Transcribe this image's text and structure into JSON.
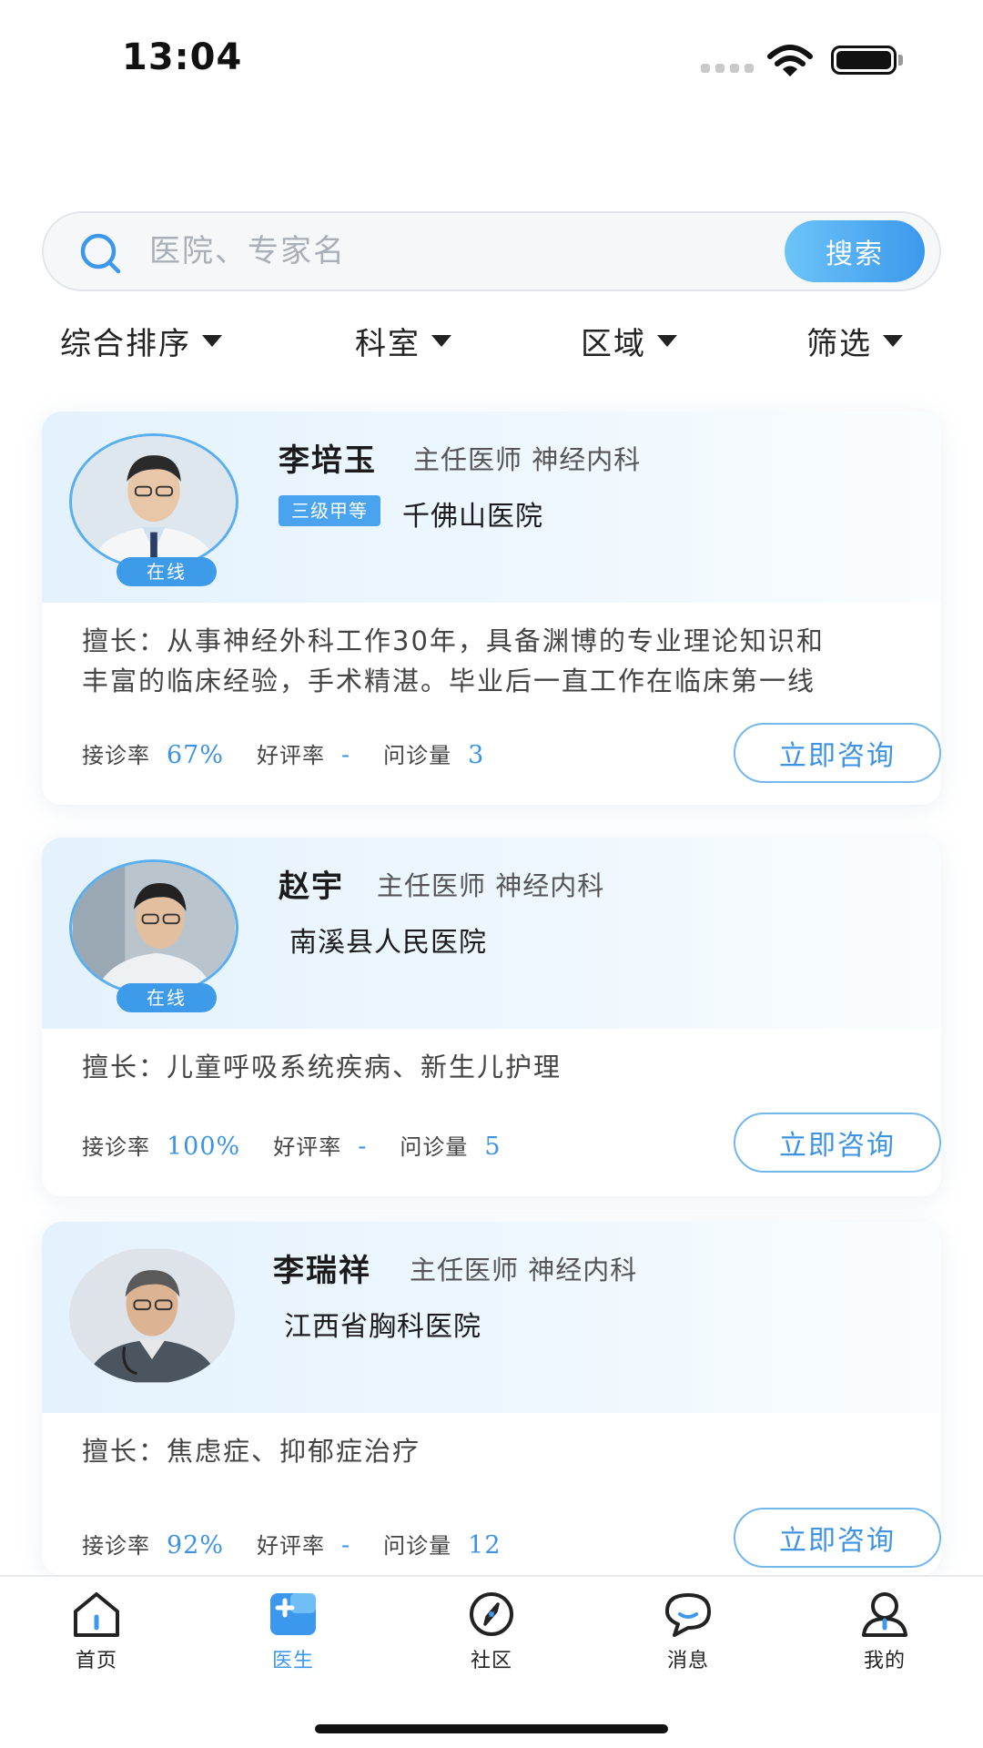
{
  "status_bar": {
    "time": "13:04"
  },
  "search": {
    "placeholder": "医院、专家名",
    "button_label": "搜索"
  },
  "filters": [
    {
      "label": "综合排序"
    },
    {
      "label": "科室"
    },
    {
      "label": "区域"
    },
    {
      "label": "筛选"
    }
  ],
  "doctors": [
    {
      "name": "李培玉",
      "title": "主任医师  神经内科",
      "level": "三级甲等",
      "hospital": "千佛山医院",
      "online": "在线",
      "specialty_line1": "擅长：从事神经外科工作30年，具备渊博的专业理论知识和",
      "specialty_line2": "丰富的临床经验，手术精湛。毕业后一直工作在临床第一线",
      "stats": {
        "rate_label": "接诊率",
        "rate": "67%",
        "praise_label": "好评率",
        "praise": "-",
        "count_label": "问诊量",
        "count": "3"
      },
      "consult_label": "立即咨询"
    },
    {
      "name": "赵宇",
      "title": "主任医师  神经内科",
      "hospital": "南溪县人民医院",
      "online": "在线",
      "specialty_line1": "擅长：儿童呼吸系统疾病、新生儿护理",
      "stats": {
        "rate_label": "接诊率",
        "rate": "100%",
        "praise_label": "好评率",
        "praise": "-",
        "count_label": "问诊量",
        "count": "5"
      },
      "consult_label": "立即咨询"
    },
    {
      "name": "李瑞祥",
      "title": "主任医师  神经内科",
      "hospital": "江西省胸科医院",
      "specialty_line1": "擅长：焦虑症、抑郁症治疗",
      "stats": {
        "rate_label": "接诊率",
        "rate": "92%",
        "praise_label": "好评率",
        "praise": "-",
        "count_label": "问诊量",
        "count": "12"
      },
      "consult_label": "立即咨询"
    }
  ],
  "tabs": [
    {
      "label": "首页",
      "icon": "home-icon"
    },
    {
      "label": "医生",
      "icon": "doctor-plus-icon",
      "active": true
    },
    {
      "label": "社区",
      "icon": "compass-icon"
    },
    {
      "label": "消息",
      "icon": "chat-bubble-icon"
    },
    {
      "label": "我的",
      "icon": "profile-icon"
    }
  ],
  "colors": {
    "accent": "#3c98ec",
    "stat_value": "#3c92e3",
    "badge": "#4aa3ee",
    "card_head": "#e4f2fd"
  }
}
